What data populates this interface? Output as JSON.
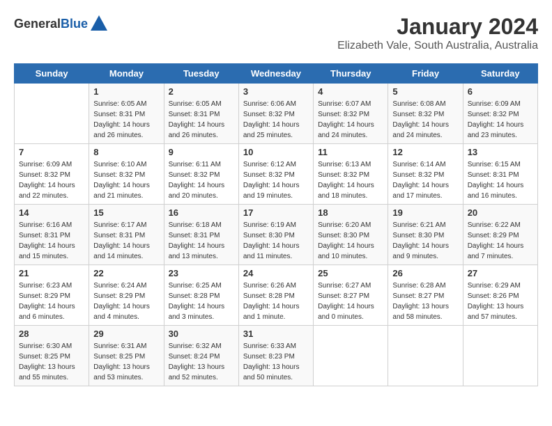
{
  "logo": {
    "general": "General",
    "blue": "Blue"
  },
  "title": "January 2024",
  "subtitle": "Elizabeth Vale, South Australia, Australia",
  "days_header": [
    "Sunday",
    "Monday",
    "Tuesday",
    "Wednesday",
    "Thursday",
    "Friday",
    "Saturday"
  ],
  "weeks": [
    [
      {
        "day": "",
        "info": ""
      },
      {
        "day": "1",
        "info": "Sunrise: 6:05 AM\nSunset: 8:31 PM\nDaylight: 14 hours\nand 26 minutes."
      },
      {
        "day": "2",
        "info": "Sunrise: 6:05 AM\nSunset: 8:31 PM\nDaylight: 14 hours\nand 26 minutes."
      },
      {
        "day": "3",
        "info": "Sunrise: 6:06 AM\nSunset: 8:32 PM\nDaylight: 14 hours\nand 25 minutes."
      },
      {
        "day": "4",
        "info": "Sunrise: 6:07 AM\nSunset: 8:32 PM\nDaylight: 14 hours\nand 24 minutes."
      },
      {
        "day": "5",
        "info": "Sunrise: 6:08 AM\nSunset: 8:32 PM\nDaylight: 14 hours\nand 24 minutes."
      },
      {
        "day": "6",
        "info": "Sunrise: 6:09 AM\nSunset: 8:32 PM\nDaylight: 14 hours\nand 23 minutes."
      }
    ],
    [
      {
        "day": "7",
        "info": "Sunrise: 6:09 AM\nSunset: 8:32 PM\nDaylight: 14 hours\nand 22 minutes."
      },
      {
        "day": "8",
        "info": "Sunrise: 6:10 AM\nSunset: 8:32 PM\nDaylight: 14 hours\nand 21 minutes."
      },
      {
        "day": "9",
        "info": "Sunrise: 6:11 AM\nSunset: 8:32 PM\nDaylight: 14 hours\nand 20 minutes."
      },
      {
        "day": "10",
        "info": "Sunrise: 6:12 AM\nSunset: 8:32 PM\nDaylight: 14 hours\nand 19 minutes."
      },
      {
        "day": "11",
        "info": "Sunrise: 6:13 AM\nSunset: 8:32 PM\nDaylight: 14 hours\nand 18 minutes."
      },
      {
        "day": "12",
        "info": "Sunrise: 6:14 AM\nSunset: 8:32 PM\nDaylight: 14 hours\nand 17 minutes."
      },
      {
        "day": "13",
        "info": "Sunrise: 6:15 AM\nSunset: 8:31 PM\nDaylight: 14 hours\nand 16 minutes."
      }
    ],
    [
      {
        "day": "14",
        "info": "Sunrise: 6:16 AM\nSunset: 8:31 PM\nDaylight: 14 hours\nand 15 minutes."
      },
      {
        "day": "15",
        "info": "Sunrise: 6:17 AM\nSunset: 8:31 PM\nDaylight: 14 hours\nand 14 minutes."
      },
      {
        "day": "16",
        "info": "Sunrise: 6:18 AM\nSunset: 8:31 PM\nDaylight: 14 hours\nand 13 minutes."
      },
      {
        "day": "17",
        "info": "Sunrise: 6:19 AM\nSunset: 8:30 PM\nDaylight: 14 hours\nand 11 minutes."
      },
      {
        "day": "18",
        "info": "Sunrise: 6:20 AM\nSunset: 8:30 PM\nDaylight: 14 hours\nand 10 minutes."
      },
      {
        "day": "19",
        "info": "Sunrise: 6:21 AM\nSunset: 8:30 PM\nDaylight: 14 hours\nand 9 minutes."
      },
      {
        "day": "20",
        "info": "Sunrise: 6:22 AM\nSunset: 8:29 PM\nDaylight: 14 hours\nand 7 minutes."
      }
    ],
    [
      {
        "day": "21",
        "info": "Sunrise: 6:23 AM\nSunset: 8:29 PM\nDaylight: 14 hours\nand 6 minutes."
      },
      {
        "day": "22",
        "info": "Sunrise: 6:24 AM\nSunset: 8:29 PM\nDaylight: 14 hours\nand 4 minutes."
      },
      {
        "day": "23",
        "info": "Sunrise: 6:25 AM\nSunset: 8:28 PM\nDaylight: 14 hours\nand 3 minutes."
      },
      {
        "day": "24",
        "info": "Sunrise: 6:26 AM\nSunset: 8:28 PM\nDaylight: 14 hours\nand 1 minute."
      },
      {
        "day": "25",
        "info": "Sunrise: 6:27 AM\nSunset: 8:27 PM\nDaylight: 14 hours\nand 0 minutes."
      },
      {
        "day": "26",
        "info": "Sunrise: 6:28 AM\nSunset: 8:27 PM\nDaylight: 13 hours\nand 58 minutes."
      },
      {
        "day": "27",
        "info": "Sunrise: 6:29 AM\nSunset: 8:26 PM\nDaylight: 13 hours\nand 57 minutes."
      }
    ],
    [
      {
        "day": "28",
        "info": "Sunrise: 6:30 AM\nSunset: 8:25 PM\nDaylight: 13 hours\nand 55 minutes."
      },
      {
        "day": "29",
        "info": "Sunrise: 6:31 AM\nSunset: 8:25 PM\nDaylight: 13 hours\nand 53 minutes."
      },
      {
        "day": "30",
        "info": "Sunrise: 6:32 AM\nSunset: 8:24 PM\nDaylight: 13 hours\nand 52 minutes."
      },
      {
        "day": "31",
        "info": "Sunrise: 6:33 AM\nSunset: 8:23 PM\nDaylight: 13 hours\nand 50 minutes."
      },
      {
        "day": "",
        "info": ""
      },
      {
        "day": "",
        "info": ""
      },
      {
        "day": "",
        "info": ""
      }
    ]
  ]
}
